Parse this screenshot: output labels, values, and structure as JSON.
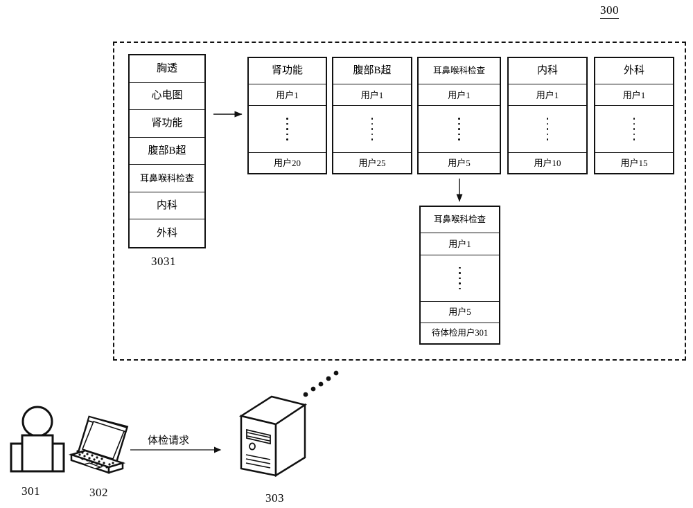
{
  "figure": {
    "number": "300"
  },
  "exam_menu": {
    "ref_label": "3031",
    "items": [
      "胸透",
      "心电图",
      "肾功能",
      "腹部B超",
      "耳鼻喉科检查",
      "内科",
      "外科"
    ]
  },
  "category_tables": [
    {
      "header": "肾功能",
      "first_user": "用户1",
      "ellipsis": "⋮",
      "last_user": "用户20"
    },
    {
      "header": "腹部B超",
      "first_user": "用户1",
      "ellipsis": "⋮",
      "last_user": "用户25"
    },
    {
      "header": "耳鼻喉科检查",
      "first_user": "用户1",
      "ellipsis": "⋮",
      "last_user": "用户5"
    },
    {
      "header": "内科",
      "first_user": "用户1",
      "ellipsis": "⋮",
      "last_user": "用户10"
    },
    {
      "header": "外科",
      "first_user": "用户1",
      "ellipsis": "⋮",
      "last_user": "用户15"
    }
  ],
  "detail_table": {
    "header": "耳鼻喉科检查",
    "first_user": "用户1",
    "ellipsis": "⋮",
    "last_user": "用户5",
    "pending_user": "待体检用户301"
  },
  "actors": {
    "user": {
      "icon": "person-icon",
      "ref_label": "301"
    },
    "terminal": {
      "icon": "laptop-icon",
      "ref_label": "302"
    },
    "server": {
      "icon": "server-icon",
      "ref_label": "303"
    },
    "request_arrow_label": "体检请求"
  },
  "colors": {
    "stroke": "#111111",
    "background": "#ffffff"
  }
}
